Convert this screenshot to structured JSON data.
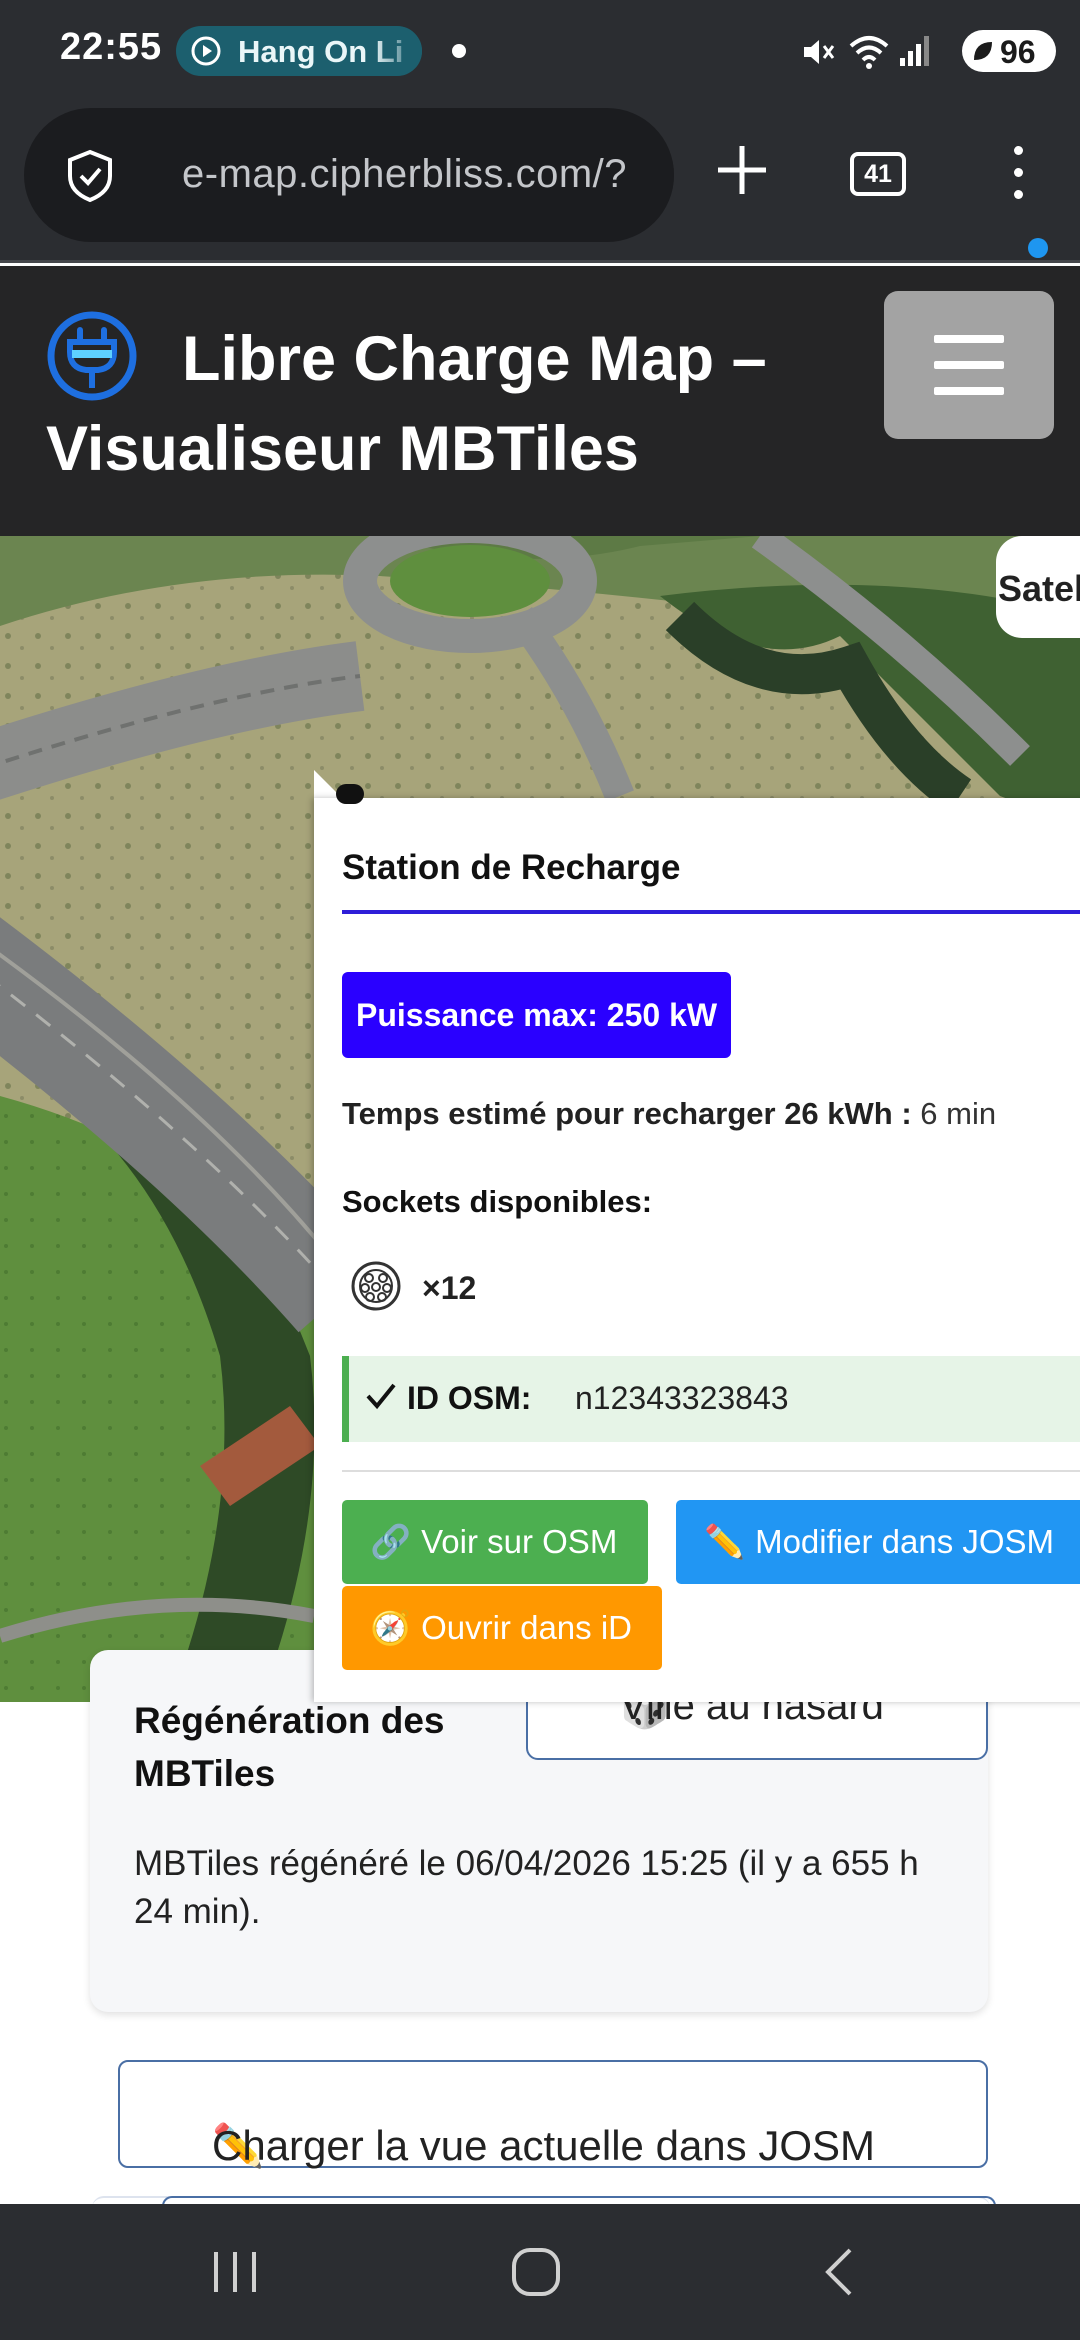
{
  "status_bar": {
    "time": "22:55",
    "media_chip": "Hang On Li",
    "battery": "96"
  },
  "browser": {
    "url": "e-map.cipherbliss.com/?",
    "tab_count": "41"
  },
  "header": {
    "title": "Libre Charge Map – Visualiseur MBTiles"
  },
  "map": {
    "satellite_button": "Satel"
  },
  "popup": {
    "title": "Station de Recharge",
    "power_badge": "Puissance max: 250 kW",
    "charge_time_label": "Temps estimé pour recharger 26 kWh :",
    "charge_time_value": "6 min",
    "sockets_label": "Sockets disponibles:",
    "socket_count": "×12",
    "osm_id_label": "ID OSM:",
    "osm_id_value": "n12343323843",
    "buttons": {
      "view_osm": "Voir sur OSM",
      "edit_josm": "Modifier dans JOSM",
      "open_id": "Ouvrir dans iD"
    }
  },
  "regen_card": {
    "title": "Régénération des MBTiles",
    "random_city_button": "Ville au hasard",
    "text": "MBTiles régénéré le 06/04/2026 15:25 (il y a 655 h 24 min)."
  },
  "load_josm_button": "Charger la vue actuelle dans JOSM",
  "colors": {
    "power_badge": "#2a00ff",
    "osm_button": "#4caf50",
    "josm_button": "#2196f3",
    "id_button": "#ff9800",
    "logo": "#1e6fe0"
  }
}
